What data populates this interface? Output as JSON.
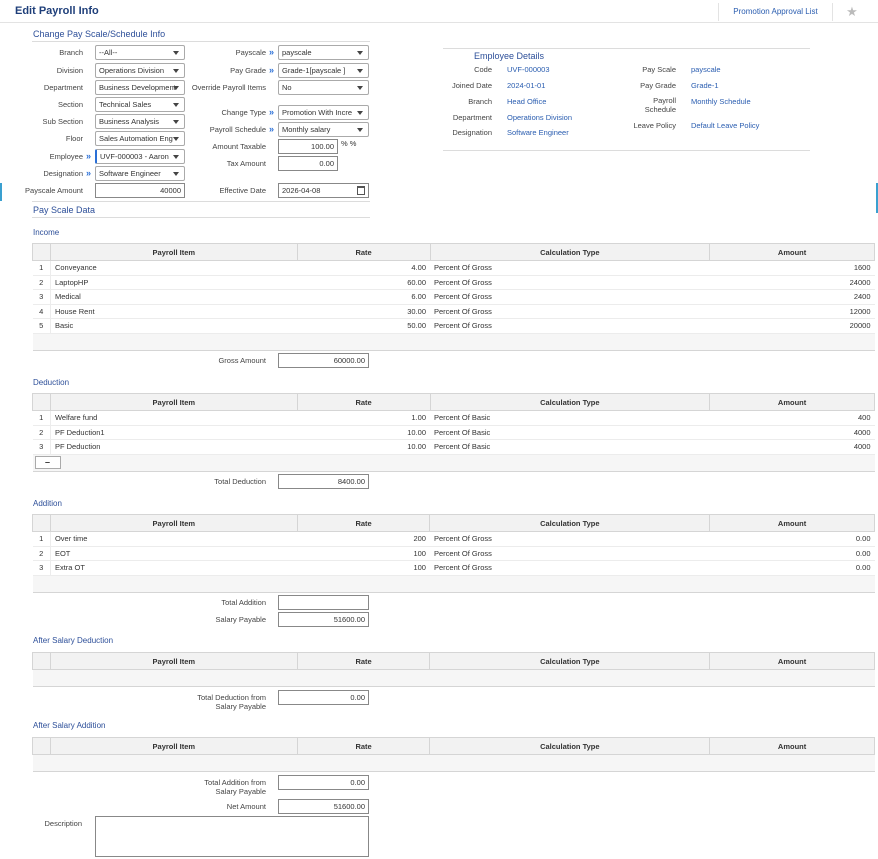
{
  "header": {
    "title": "Edit Payroll Info",
    "promo_link": "Promotion Approval List"
  },
  "change_section": {
    "title": "Change Pay Scale/Schedule Info"
  },
  "left_form": {
    "branch": {
      "label": "Branch",
      "value": "--All--"
    },
    "division": {
      "label": "Division",
      "value": "Operations Division"
    },
    "department": {
      "label": "Department",
      "value": "Business Development"
    },
    "section": {
      "label": "Section",
      "value": "Technical Sales"
    },
    "sub_section": {
      "label": "Sub Section",
      "value": "Business Analysis"
    },
    "floor": {
      "label": "Floor",
      "value": "Sales Automation Eng"
    },
    "employee": {
      "label": "Employee",
      "value": "UVF-000003 - Aaron"
    },
    "designation": {
      "label": "Designation",
      "value": "Software Engineer"
    },
    "payscale_amount": {
      "label": "Payscale Amount",
      "value": "40000"
    }
  },
  "mid_form": {
    "payscale": {
      "label": "Payscale",
      "value": "payscale"
    },
    "pay_grade": {
      "label": "Pay Grade",
      "value": "Grade-1[payscale ]"
    },
    "override_payroll": {
      "label": "Override Payroll Items",
      "value": "No"
    },
    "change_type": {
      "label": "Change Type",
      "value": "Promotion With Incre"
    },
    "payroll_schedule": {
      "label": "Payroll Schedule",
      "value": "Monthly salary"
    },
    "amount_taxable": {
      "label": "Amount Taxable",
      "value": "100.00",
      "suffix": "% %"
    },
    "tax_amount": {
      "label": "Tax Amount",
      "value": "0.00"
    },
    "effective_date": {
      "label": "Effective Date",
      "value": "2026-04-08"
    }
  },
  "employee_details": {
    "title": "Employee Details",
    "left": [
      {
        "label": "Code",
        "value": "UVF-000003"
      },
      {
        "label": "Joined Date",
        "value": "2024-01-01"
      },
      {
        "label": "Branch",
        "value": "Head Office"
      },
      {
        "label": "Department",
        "value": "Operations Division"
      },
      {
        "label": "Designation",
        "value": "Software Engineer"
      }
    ],
    "right": [
      {
        "label": "Pay Scale",
        "value": "payscale"
      },
      {
        "label": "Pay Grade",
        "value": "Grade-1"
      },
      {
        "label": "Payroll Schedule",
        "value": "Monthly Schedule"
      },
      {
        "label": "Leave Policy",
        "value": "Default Leave Policy"
      }
    ]
  },
  "pay_scale_data": {
    "title": "Pay Scale Data"
  },
  "columns": {
    "item": "Payroll Item",
    "rate": "Rate",
    "calc": "Calculation Type",
    "amount": "Amount"
  },
  "income": {
    "title": "Income",
    "rows": [
      {
        "idx": "1",
        "item": "Conveyance",
        "rate": "4.00",
        "calc": "Percent Of Gross",
        "amount": "1600"
      },
      {
        "idx": "2",
        "item": "LaptopHP",
        "rate": "60.00",
        "calc": "Percent Of Gross",
        "amount": "24000"
      },
      {
        "idx": "3",
        "item": "Medical",
        "rate": "6.00",
        "calc": "Percent Of Gross",
        "amount": "2400"
      },
      {
        "idx": "4",
        "item": "House Rent",
        "rate": "30.00",
        "calc": "Percent Of Gross",
        "amount": "12000"
      },
      {
        "idx": "5",
        "item": "Basic",
        "rate": "50.00",
        "calc": "Percent Of Gross",
        "amount": "20000"
      }
    ],
    "total_label": "Gross Amount",
    "total_value": "60000.00"
  },
  "deduction": {
    "title": "Deduction",
    "rows": [
      {
        "idx": "1",
        "item": "Welfare fund",
        "rate": "1.00",
        "calc": "Percent Of Basic",
        "amount": "400"
      },
      {
        "idx": "2",
        "item": "PF Deduction1",
        "rate": "10.00",
        "calc": "Percent Of Basic",
        "amount": "4000"
      },
      {
        "idx": "3",
        "item": "PF Deduction",
        "rate": "10.00",
        "calc": "Percent Of Basic",
        "amount": "4000"
      }
    ],
    "minus_label": "–",
    "total_label": "Total Deduction",
    "total_value": "8400.00"
  },
  "addition": {
    "title": "Addition",
    "rows": [
      {
        "idx": "1",
        "item": "Over time",
        "rate": "200",
        "calc": "Percent Of Gross",
        "amount": "0.00"
      },
      {
        "idx": "2",
        "item": "EOT",
        "rate": "100",
        "calc": "Percent Of Gross",
        "amount": "0.00"
      },
      {
        "idx": "3",
        "item": "Extra OT",
        "rate": "100",
        "calc": "Percent Of Gross",
        "amount": "0.00"
      }
    ],
    "total_label": "Total Addition",
    "total_value": "",
    "payable_label": "Salary Payable",
    "payable_value": "51600.00"
  },
  "after_deduction": {
    "title": "After Salary Deduction",
    "total_label_1": "Total Deduction from",
    "total_label_2": "Salary Payable",
    "total_value": "0.00"
  },
  "after_addition": {
    "title": "After Salary Addition",
    "total_label_1": "Total Addition from",
    "total_label_2": "Salary Payable",
    "total_value": "0.00",
    "net_label": "Net Amount",
    "net_value": "51600.00",
    "desc_label": "Description"
  }
}
